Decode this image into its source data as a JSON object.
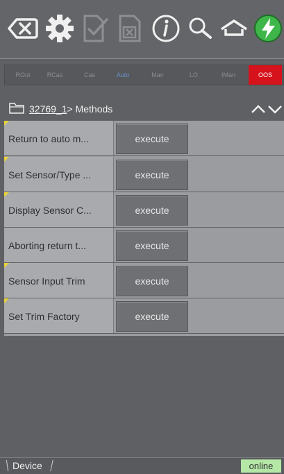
{
  "toolbar": {
    "buttons": [
      {
        "icon": "backspace-icon",
        "enabled": true
      },
      {
        "icon": "gear-icon",
        "enabled": true
      },
      {
        "icon": "check-document-icon",
        "enabled": false
      },
      {
        "icon": "cancel-document-icon",
        "enabled": false
      },
      {
        "icon": "info-icon",
        "enabled": true
      },
      {
        "icon": "search-icon",
        "enabled": true
      },
      {
        "icon": "home-icon",
        "enabled": true
      },
      {
        "icon": "lightning-icon",
        "enabled": true
      }
    ],
    "accent": "#3fb64a"
  },
  "modes": {
    "items": [
      "ROut",
      "RCas",
      "Cas",
      "Auto",
      "Man",
      "LO",
      "IMan",
      "OOS"
    ],
    "active": "Auto",
    "status": "OOS",
    "status_color": "#d6121c"
  },
  "path": {
    "link": "32769_1",
    "rest": "> Methods"
  },
  "methods": [
    {
      "label": "Return to auto m...",
      "flag": true,
      "action": "execute"
    },
    {
      "label": "Set Sensor/Type ...",
      "flag": true,
      "action": "execute"
    },
    {
      "label": "Display Sensor C...",
      "flag": true,
      "action": "execute"
    },
    {
      "label": "Aborting return t...",
      "flag": false,
      "action": "execute"
    },
    {
      "label": "Sensor Input Trim",
      "flag": true,
      "action": "execute"
    },
    {
      "label": "Set Trim Factory",
      "flag": true,
      "action": "execute"
    }
  ],
  "footer": {
    "tab": "Device",
    "status": "online",
    "status_color": "#b5e7a6"
  }
}
